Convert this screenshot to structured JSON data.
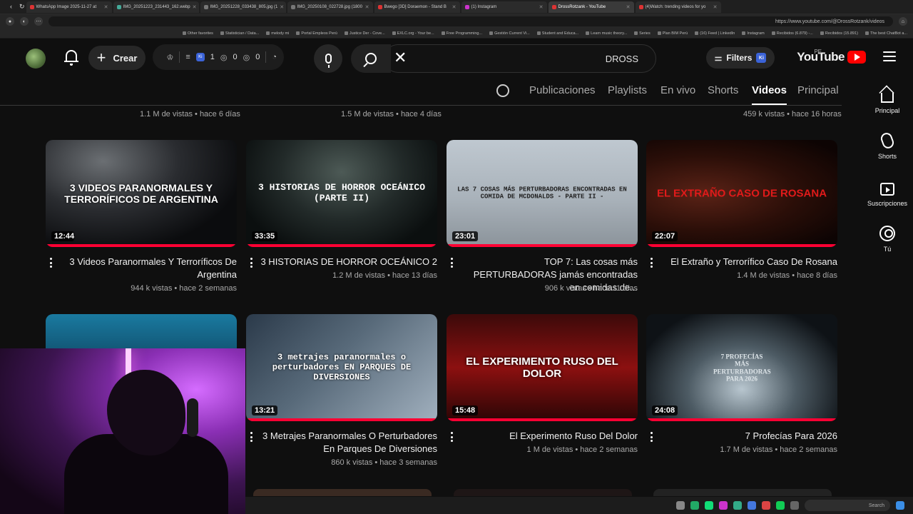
{
  "browser": {
    "tabs": [
      {
        "title": "(4)Watch: trending videos for yo"
      },
      {
        "title": "DrossRotzank - YouTube",
        "active": true
      },
      {
        "title": "(1) Instagram"
      },
      {
        "title": "Bwego [3D] Doraemon - Stand B"
      },
      {
        "title": "IMG_20250108_022728.jpg (1800"
      },
      {
        "title": "IMG_20251228_033438_805.jpg (1"
      },
      {
        "title": "IMG_20251223_231443_162.webp"
      },
      {
        "title": "WhatsApp Image 2025-11-27 at"
      }
    ],
    "url": "https://www.youtube.com/@DrossRotzank/videos",
    "bookmarks": [
      "The best ChatBot a...",
      "Recibidos (15.891)",
      "Recibidos (6.879) -...",
      "Instagram",
      "(16) Feed | LinkedIn",
      "Plan BIM Perú",
      "Series",
      "Learn music theory...",
      "Student and Educa...",
      "Gestión Current Vi...",
      "Free Programming...",
      "EXLC.org - Your be...",
      "Justice Der - Cove...",
      "Portal Empleos Perú",
      "melody mi",
      "Statistician / Data...",
      "Other favorites"
    ]
  },
  "header": {
    "logo_text": "YouTube",
    "country": "PE",
    "filters_label": "Filters",
    "filters_badge": "Ki",
    "search_query": "DROSS",
    "clear_symbol": "✕",
    "create_label": "Crear",
    "ext_counts": [
      "0",
      "0",
      "1"
    ],
    "ext_badge": "Ki"
  },
  "channel_tabs": {
    "principal": "Principal",
    "videos": "Videos",
    "shorts": "Shorts",
    "en_vivo": "En vivo",
    "playlists": "Playlists",
    "publicaciones": "Publicaciones"
  },
  "rail": {
    "principal": "Principal",
    "shorts": "Shorts",
    "suscripciones": "Suscripciones",
    "tu": "Tú"
  },
  "above_meta": [
    "1.1 M de vistas • hace 6 días",
    "1.5 M de vistas • hace 4 días",
    "459 k vistas • hace 16 horas"
  ],
  "videos_row1": [
    {
      "title": "3 Videos Paranormales Y Terroríficos De Argentina",
      "meta": "944 k vistas • hace 2 semanas",
      "duration": "12:44",
      "thumb_text": "3 VIDEOS PARANORMALES Y TERRORÍFICOS DE ARGENTINA"
    },
    {
      "title": "3 HISTORIAS DE HORROR OCEÁNICO 2",
      "meta": "1.2 M de vistas • hace 13 días",
      "duration": "33:35",
      "thumb_text": "3 HISTORIAS DE HORROR OCEÁNICO (PARTE II)"
    },
    {
      "title": "TOP 7: Las cosas más PERTURBADORAS jamás encontradas en comidas de...",
      "meta": "906 k vistas • hace 11 días",
      "duration": "23:01",
      "thumb_text": "LAS 7 COSAS MÁS PERTURBADORAS ENCONTRADAS EN COMIDA DE MCDONALDS - PARTE II -"
    },
    {
      "title": "El Extraño y Terrorífico Caso De Rosana",
      "meta": "1.4 M de vistas • hace 8 días",
      "duration": "22:07",
      "thumb_text": "EL EXTRAÑO CASO DE ROSANA"
    }
  ],
  "videos_row2": [
    {
      "title": "",
      "meta": "",
      "duration": "",
      "thumb_text": ""
    },
    {
      "title": "3 Metrajes Paranormales O Perturbadores En Parques De Diversiones",
      "meta": "860 k vistas • hace 3 semanas",
      "duration": "13:21",
      "thumb_text": "3 metrajes paranormales o perturbadores EN PARQUES DE DIVERSIONES"
    },
    {
      "title": "El Experimento Ruso Del Dolor",
      "meta": "1 M de vistas • hace 2 semanas",
      "duration": "15:48",
      "thumb_text": "EL EXPERIMENTO RUSO DEL DOLOR"
    },
    {
      "title": "7 Profecías Para 2026",
      "meta": "1.7 M de vistas • hace 2 semanas",
      "duration": "24:08",
      "thumb_text": "7 PROFECÍAS MÁS PERTURBADORAS PARA 2026"
    }
  ],
  "taskbar": {
    "search_label": "Search"
  },
  "colors": {
    "accent": "#ff0033",
    "background": "#0f0f0f",
    "logo_red": "#ff0000"
  }
}
